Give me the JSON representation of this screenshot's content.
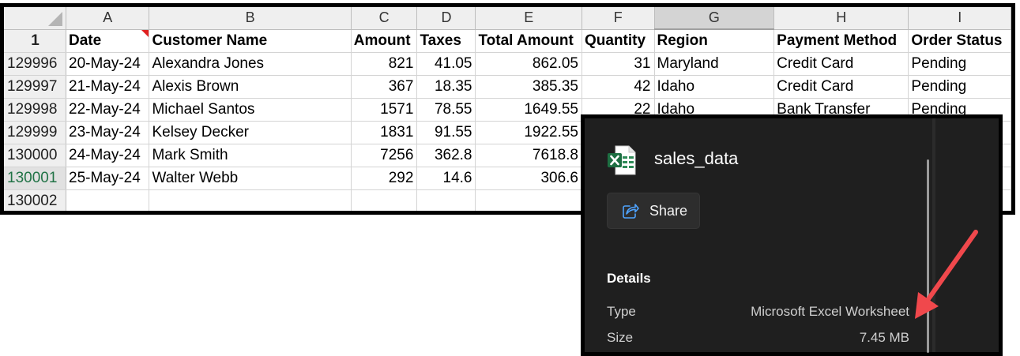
{
  "sheet": {
    "columns": [
      "A",
      "B",
      "C",
      "D",
      "E",
      "F",
      "G",
      "H",
      "I"
    ],
    "selected_column": "G",
    "header_row": {
      "row_number": "1",
      "cells": [
        "Date",
        "Customer Name",
        "Amount",
        "Taxes",
        "Total Amount",
        "Quantity",
        "Region",
        "Payment Method",
        "Order Status"
      ]
    },
    "rows": [
      {
        "row_number": "129996",
        "cells": [
          "20-May-24",
          "Alexandra Jones",
          "821",
          "41.05",
          "862.05",
          "31",
          "Maryland",
          "Credit Card",
          "Pending"
        ]
      },
      {
        "row_number": "129997",
        "cells": [
          "21-May-24",
          "Alexis Brown",
          "367",
          "18.35",
          "385.35",
          "42",
          "Idaho",
          "Credit Card",
          "Pending"
        ]
      },
      {
        "row_number": "129998",
        "cells": [
          "22-May-24",
          "Michael Santos",
          "1571",
          "78.55",
          "1649.55",
          "22",
          "Idaho",
          "Bank Transfer",
          "Pending"
        ]
      },
      {
        "row_number": "129999",
        "cells": [
          "23-May-24",
          "Kelsey Decker",
          "1831",
          "91.55",
          "1922.55",
          "",
          "",
          "",
          ""
        ]
      },
      {
        "row_number": "130000",
        "cells": [
          "24-May-24",
          "Mark Smith",
          "7256",
          "362.8",
          "7618.8",
          "",
          "",
          "",
          ""
        ]
      },
      {
        "row_number": "130001",
        "cells": [
          "25-May-24",
          "Walter Webb",
          "292",
          "14.6",
          "306.6",
          "",
          "",
          "",
          ""
        ]
      },
      {
        "row_number": "130002",
        "cells": [
          "",
          "",
          "",
          "",
          "",
          "",
          "",
          "",
          ""
        ]
      }
    ],
    "active_row_number": "130001"
  },
  "panel": {
    "file_name": "sales_data",
    "file_icon": "excel-file-icon",
    "share_icon": "share-icon",
    "share_label": "Share",
    "details_heading": "Details",
    "details": [
      {
        "label": "Type",
        "value": "Microsoft Excel Worksheet"
      },
      {
        "label": "Size",
        "value": "7.45 MB"
      }
    ]
  },
  "annotation": {
    "arrow_color": "#f0484c",
    "points_to": "size-value"
  },
  "colors": {
    "excel_green": "#1d6f42",
    "panel_bg": "#1f1f1f",
    "active_row_header": "#217346"
  }
}
